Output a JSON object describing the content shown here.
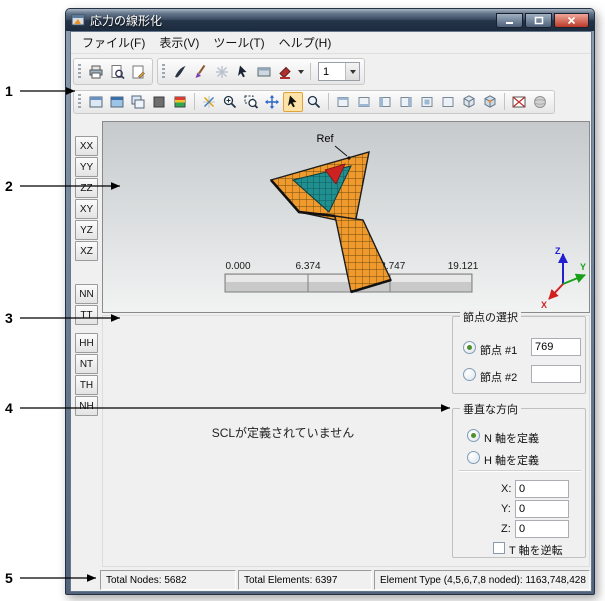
{
  "callouts": [
    "1",
    "2",
    "3",
    "4",
    "5"
  ],
  "window": {
    "title": "応力の線形化"
  },
  "menu": {
    "items": [
      "ファイル(F)",
      "表示(V)",
      "ツール(T)",
      "ヘルプ(H)"
    ]
  },
  "toolbar_top": {
    "icons": [
      "print-icon",
      "print-preview-icon",
      "page-setup-icon",
      "pen-icon",
      "brush-icon",
      "clear-selection-icon",
      "pointer-icon",
      "box-icon",
      "paint-icon",
      "dropdown-arrow-icon"
    ],
    "scale_value": "1"
  },
  "toolbar_view": {
    "icons": [
      "viewport-icon",
      "viewport-shaded-icon",
      "viewport-multi-icon",
      "solid-gray-icon",
      "contour-icon",
      "axes-icon",
      "zoom-in-icon",
      "zoom-window-icon",
      "pan-icon",
      "select-arrow-icon",
      "zoom-icon",
      "view-front-icon",
      "view-back-icon",
      "view-left-icon",
      "view-right-icon",
      "view-top-icon",
      "view-bottom-icon",
      "view-iso-icon",
      "view-dimetric-icon",
      "element-x-icon",
      "sphere-icon"
    ]
  },
  "stress_buttons": [
    "XX",
    "YY",
    "ZZ",
    "XY",
    "YZ",
    "XZ",
    "NN",
    "TT",
    "HH",
    "NT",
    "TH",
    "NH"
  ],
  "viewport": {
    "ref_label": "Ref",
    "ruler": [
      "0.000",
      "6.374",
      "12.747",
      "19.121"
    ],
    "axis": {
      "x": "X",
      "y": "Y",
      "z": "Z"
    }
  },
  "colors": {
    "mesh_orange": "#f09a2e",
    "mesh_teal": "#1f8f8f",
    "highlight_red": "#cc2222"
  },
  "message": {
    "text": "SCLが定義されていません"
  },
  "node_selection": {
    "title": "節点の選択",
    "node1_label": "節点 #1",
    "node1_value": "769",
    "node2_label": "節点 #2",
    "node2_value": ""
  },
  "direction": {
    "title": "垂直な方向",
    "n_axis_label": "N 軸を定義",
    "h_axis_label": "H 軸を定義",
    "x_label": "X:",
    "y_label": "Y:",
    "z_label": "Z:",
    "x_value": "0",
    "y_value": "0",
    "z_value": "0",
    "invert_label": "T 軸を逆転"
  },
  "statusbar": {
    "nodes": "Total Nodes: 5682",
    "elements": "Total Elements: 6397",
    "element_type": "Element Type (4,5,6,7,8 noded): 1163,748,428"
  }
}
